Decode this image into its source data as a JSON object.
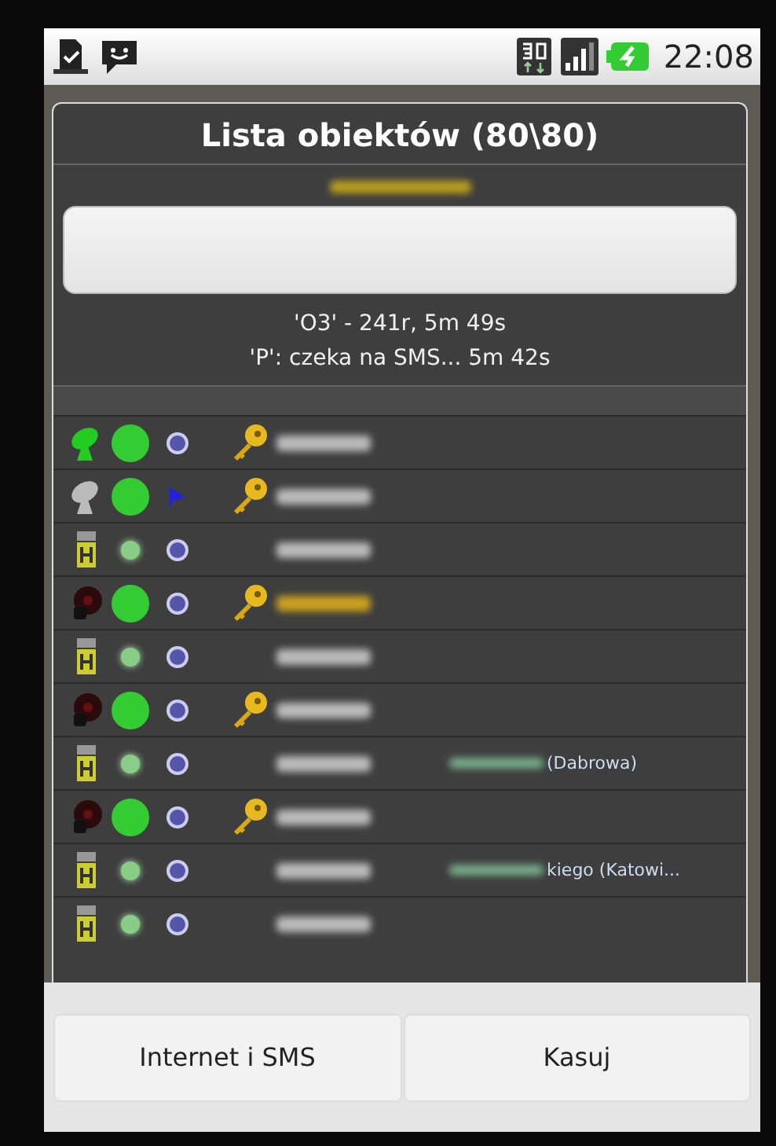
{
  "status_bar": {
    "time": "22:08"
  },
  "dialog": {
    "title": "Lista obiektów (80\\80)",
    "info_lines": [
      "'O3' - 241r, 5m 49s",
      "'P': czeka na SMS... 5m 42s"
    ],
    "rows": [
      {
        "kind": "antenna",
        "color": "#22cc22",
        "online": true,
        "flag": false,
        "key": true,
        "highlighted": false
      },
      {
        "kind": "antenna",
        "color": "#bbbbbb",
        "online": true,
        "flag": true,
        "key": true,
        "highlighted": false
      },
      {
        "kind": "sign",
        "online": false,
        "flag": false,
        "key": false,
        "highlighted": false
      },
      {
        "kind": "bulb",
        "online": true,
        "flag": false,
        "key": true,
        "highlighted": true
      },
      {
        "kind": "sign",
        "online": false,
        "flag": false,
        "key": false,
        "highlighted": false
      },
      {
        "kind": "bulb",
        "online": true,
        "flag": false,
        "key": true,
        "highlighted": false
      },
      {
        "kind": "sign",
        "online": false,
        "flag": false,
        "key": false,
        "highlighted": false,
        "location": "(Dabrowa)"
      },
      {
        "kind": "bulb",
        "online": true,
        "flag": false,
        "key": true,
        "highlighted": false
      },
      {
        "kind": "sign",
        "online": false,
        "flag": false,
        "key": false,
        "highlighted": false,
        "location": "kiego (Katowi..."
      },
      {
        "kind": "sign",
        "online": false,
        "flag": false,
        "key": false,
        "highlighted": false
      }
    ]
  },
  "buttons": [
    "Internet i SMS",
    "Kasuj"
  ]
}
